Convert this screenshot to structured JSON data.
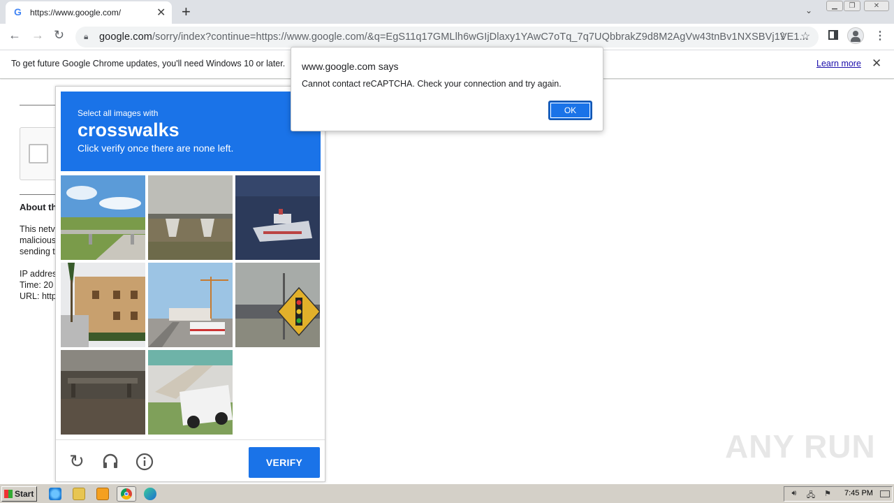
{
  "browser": {
    "tab_title": "https://www.google.com/",
    "tab_favicon": "G",
    "url_host": "google.com",
    "url_rest": "/sorry/index?continue=https://www.google.com/&q=EgS11q17GMLlh6wGIjDlaxy1YAwC7oTq_7q7UQbbrakZ9d8M2AgVw43tnBv1NXSBVj1VE1...",
    "icons": [
      "google-favicon",
      "close-icon",
      "plus-icon",
      "chevron-down-icon",
      "back-icon",
      "forward-icon",
      "reload-icon",
      "lock-icon",
      "share-icon",
      "star-icon",
      "side-panel-icon",
      "profile-icon",
      "menu-icon"
    ]
  },
  "infobar": {
    "message": "To get future Google Chrome updates, you'll need Windows 10 or later.",
    "link": "Learn more"
  },
  "page": {
    "about_title": "About th",
    "lines": [
      "This netv",
      "malicious",
      "sending t",
      "IP addres",
      "Time: 20",
      "URL: http"
    ]
  },
  "recaptcha": {
    "instruction_small": "Select all images with",
    "target": "crosswalks",
    "instruction_sub": "Click verify once there are none left.",
    "verify_label": "VERIFY",
    "tiles": [
      "overpass-bridge-road",
      "overpass-bridge-field",
      "ship-on-fabric",
      "apartment-building-palms",
      "street-bus-crane",
      "traffic-signal-sign",
      "park-bench",
      "car-stairs",
      "empty"
    ],
    "footer_icons": [
      "reload-icon",
      "headphones-icon",
      "info-icon"
    ]
  },
  "alert": {
    "title": "www.google.com says",
    "message": "Cannot contact reCAPTCHA. Check your connection and try again.",
    "ok_label": "OK"
  },
  "watermark": "ANY RUN",
  "taskbar": {
    "start_label": "Start",
    "clock": "7:45 PM",
    "apps": [
      "ie-icon",
      "explorer-icon",
      "media-player-icon",
      "chrome-icon",
      "edge-icon"
    ]
  }
}
